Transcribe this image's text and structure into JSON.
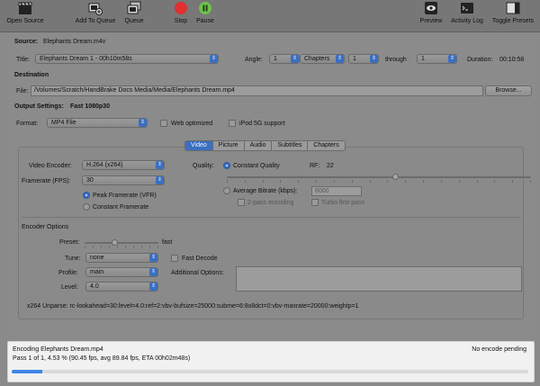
{
  "toolbar": {
    "open_source": "Open Source",
    "add_to_queue": "Add To Queue",
    "queue": "Queue",
    "stop": "Stop",
    "pause": "Pause",
    "preview": "Preview",
    "activity_log": "Activity Log",
    "toggle_presets": "Toggle Presets"
  },
  "source": {
    "label": "Source:",
    "value": "Elephants Dream.m4v"
  },
  "title_row": {
    "title_label": "Title:",
    "title_value": "Elephants Dream 1 - 00h10m58s",
    "angle_label": "Angle:",
    "angle_value": "1",
    "mode_value": "Chapters",
    "from_value": "1",
    "through_label": "through",
    "to_value": "1",
    "duration_label": "Duration:",
    "duration_value": "00:10:58"
  },
  "destination": {
    "heading": "Destination",
    "file_label": "File:",
    "file_value": "/Volumes/Scratch/HandBrake Docs Media/Media/Elephants Dream.mp4",
    "browse": "Browse..."
  },
  "output": {
    "label": "Output Settings:",
    "preset": "Fast 1080p30",
    "format_label": "Format:",
    "format_value": "MP4 File",
    "web_optimized": "Web optimized",
    "ipod": "iPod 5G support"
  },
  "tabs": [
    "Video",
    "Picture",
    "Audio",
    "Subtitles",
    "Chapters"
  ],
  "video": {
    "encoder_label": "Video Encoder:",
    "encoder_value": "H.264 (x264)",
    "framerate_label": "Framerate (FPS):",
    "framerate_value": "30",
    "peak": "Peak Framerate (VFR)",
    "constant": "Constant Framerate",
    "quality_label": "Quality:",
    "constant_quality": "Constant Quality",
    "rf_label": "RF:",
    "rf_value": "22",
    "avg_bitrate": "Average Bitrate (kbps):",
    "bitrate_value": "6000",
    "two_pass": "2-pass encoding",
    "turbo": "Turbo first pass"
  },
  "encoder_options": {
    "heading": "Encoder Options",
    "preset_label": "Preset:",
    "preset_value": "fast",
    "preset_level": 0.4,
    "tune_label": "Tune:",
    "tune_value": "none",
    "fast_decode": "Fast Decode",
    "profile_label": "Profile:",
    "profile_value": "main",
    "additional_label": "Additional Options:",
    "level_label": "Level:",
    "level_value": "4.0",
    "unparse": "x264 Unparse: rc-lookahead=30:level=4.0:ref=2:vbv-bufsize=25000:subme=6:8x8dct=0:vbv-maxrate=20000:weightp=1"
  },
  "status": {
    "encoding": "Encoding Elephants Dream.mp4",
    "pending": "No encode pending",
    "pass": "Pass 1 of 1, 4.53 % (90.45 fps, avg 89.84 fps, ETA 00h02m48s)",
    "progress": 0.0453
  },
  "colors": {
    "accent": "#3b6fc0",
    "stop": "#e03030",
    "pause": "#6fc24a",
    "progress": "#3f86e6"
  }
}
